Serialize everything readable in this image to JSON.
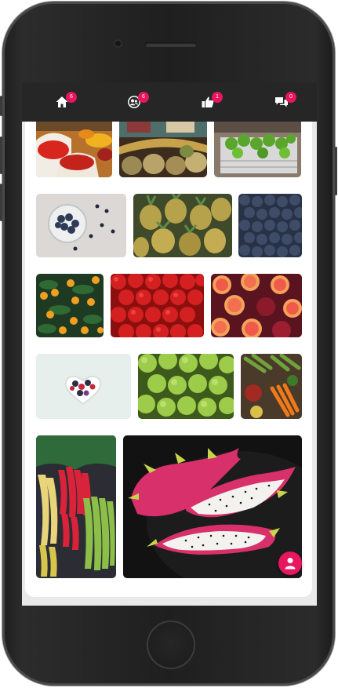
{
  "nav": [
    {
      "id": "home",
      "icon": "home-icon",
      "count": "6"
    },
    {
      "id": "friends",
      "icon": "users-icon",
      "count": "6"
    },
    {
      "id": "likes",
      "icon": "thumbs-up-icon",
      "count": "1"
    },
    {
      "id": "messages",
      "icon": "chat-icon",
      "count": "0"
    }
  ],
  "gallery": {
    "photos": [
      "spices-market",
      "coconuts-stall",
      "limes-crate",
      "blueberries-bowl",
      "pineapples",
      "blueberries-closeup",
      "oranges-tree",
      "tomatoes",
      "grapefruit-pomegranate",
      "heart-berries-bowl",
      "green-apples",
      "vegetables-spread",
      "bananas-bunches",
      "dragon-fruit"
    ]
  },
  "fab": {
    "icon": "user-icon"
  },
  "colors": {
    "accent": "#e8155f",
    "topbar": "#262626",
    "frame": "#1f1f1f"
  }
}
